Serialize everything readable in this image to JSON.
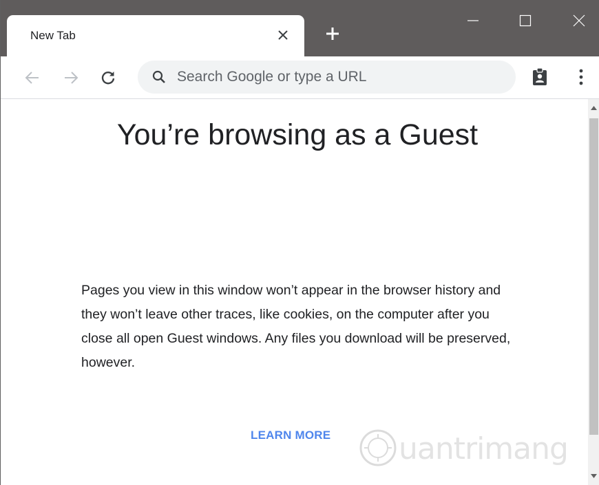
{
  "tab": {
    "title": "New Tab",
    "close_icon": "close-icon"
  },
  "titlebar": {
    "new_tab_icon": "plus-icon",
    "minimize_icon": "minimize-icon",
    "maximize_icon": "maximize-icon",
    "close_window_icon": "close-icon"
  },
  "toolbar": {
    "back_icon": "arrow-left-icon",
    "forward_icon": "arrow-right-icon",
    "reload_icon": "reload-icon",
    "omnibox_placeholder": "Search Google or type a URL",
    "profile_icon": "guest-badge-icon",
    "menu_icon": "more-vert-icon"
  },
  "content": {
    "heading": "You’re browsing as a Guest",
    "description": "Pages you view in this window won’t appear in the browser history and they won’t leave other traces, like cookies, on the computer after you close all open Guest windows. Any files you download will be preserved, however.",
    "learn_more": "LEARN MORE",
    "watermark_text": "uantrimang"
  },
  "colors": {
    "titlebar": "#5f5c5c",
    "link": "#4f86ec",
    "omnibox": "#f1f3f4"
  }
}
